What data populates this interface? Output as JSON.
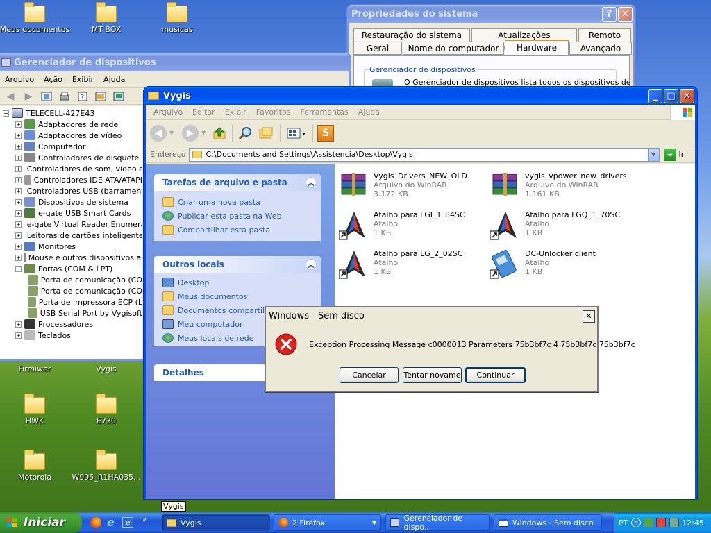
{
  "desktop": {
    "icons": [
      {
        "label": "Meus documentos"
      },
      {
        "label": "MT BOX"
      },
      {
        "label": "musicas"
      },
      {
        "label": "Firmiwer"
      },
      {
        "label": "Vygis"
      },
      {
        "label": "HWK"
      },
      {
        "label": "E730"
      },
      {
        "label": "Motorola"
      },
      {
        "label": "W995_R1HA035..."
      }
    ]
  },
  "sysprops": {
    "title": "Propriedades do sistema",
    "help_glyph": "?",
    "close_glyph": "✕",
    "tabs_row1": [
      "Restauração do sistema",
      "Atualizações Automáticas",
      "Remoto"
    ],
    "tabs_row2": [
      "Geral",
      "Nome do computador",
      "Hardware",
      "Avançado"
    ],
    "group_label": "Gerenciador de dispositivos",
    "group_text": "O Gerenciador de dispositivos lista todos os dispositivos de"
  },
  "devmgr": {
    "title": "Gerenciador de dispositivos",
    "menu": [
      "Arquivo",
      "Ação",
      "Exibir",
      "Ajuda"
    ],
    "root": "TELECELL-427E43",
    "items": [
      {
        "label": "Adaptadores de rede",
        "icon": "network-icon"
      },
      {
        "label": "Adaptadores de vídeo",
        "icon": "display-icon"
      },
      {
        "label": "Computador",
        "icon": "computer-icon"
      },
      {
        "label": "Controladores de disquete",
        "icon": "floppy-icon"
      },
      {
        "label": "Controladores de som, vídeo e",
        "icon": "sound-icon"
      },
      {
        "label": "Controladores IDE ATA/ATAPI",
        "icon": "ide-icon"
      },
      {
        "label": "Controladores USB (barrament",
        "icon": "usb-icon"
      },
      {
        "label": "Dispositivos de sistema",
        "icon": "system-icon"
      },
      {
        "label": "e-gate USB Smart Cards",
        "icon": "smartcard-icon"
      },
      {
        "label": "e-gate Virtual Reader Enumera",
        "icon": "smartcard-icon"
      },
      {
        "label": "Leitoras de cartões inteligentes",
        "icon": "cardreader-icon"
      },
      {
        "label": "Monitores",
        "icon": "monitor-icon"
      },
      {
        "label": "Mouse e outros dispositivos ap",
        "icon": "mouse-icon"
      },
      {
        "label": "Portas (COM & LPT)",
        "icon": "port-icon"
      }
    ],
    "ports_children": [
      "Porta de comunicação (CO",
      "Porta de comunicação (CO",
      "Porta de impressora ECP (L",
      "USB Serial Port by Vygisoft"
    ],
    "after_ports": [
      {
        "label": "Processadores",
        "icon": "cpu-icon"
      },
      {
        "label": "Teclados",
        "icon": "keyboard-icon"
      }
    ]
  },
  "explorer": {
    "title": "Vygis",
    "menu": [
      "Arquivo",
      "Editar",
      "Exibir",
      "Favoritos",
      "Ferramentas",
      "Ajuda"
    ],
    "address_label": "Endereço",
    "address_value": "C:\\Documents and Settings\\Assistencia\\Desktop\\Vygis",
    "go_label": "Ir",
    "tasks_title": "Tarefas de arquivo e pasta",
    "tasks": [
      "Criar uma nova pasta",
      "Publicar esta pasta na Web",
      "Compartilhar esta pasta"
    ],
    "places_title": "Outros locais",
    "places": [
      "Desktop",
      "Meus documentos",
      "Documentos compartilhados",
      "Meu computador",
      "Meus locais de rede"
    ],
    "details_title": "Detalhes",
    "files": [
      {
        "name": "Vygis_Drivers_NEW_OLD",
        "type": "Arquivo do WinRAR",
        "size": "3.172 KB",
        "icon": "winrar-icon"
      },
      {
        "name": "vygis_vpower_new_drivers",
        "type": "Arquivo do WinRAR",
        "size": "1.161 KB",
        "icon": "winrar-icon"
      },
      {
        "name": "Atalho para LGI_1_84SC",
        "type": "Atalho",
        "size": "1 KB",
        "icon": "shortcut-arrow-icon"
      },
      {
        "name": "Atalho para LGQ_1_70SC",
        "type": "Atalho",
        "size": "1 KB",
        "icon": "shortcut-arrow-icon"
      },
      {
        "name": "Atalho para LG_2_02SC",
        "type": "Atalho",
        "size": "1 KB",
        "icon": "shortcut-arrow-icon"
      },
      {
        "name": "DC-Unlocker client",
        "type": "Atalho",
        "size": "1 KB",
        "icon": "dc-unlocker-icon"
      }
    ]
  },
  "dialog": {
    "title": "Windows - Sem disco",
    "close_glyph": "✕",
    "message": "Exception Processing Message c0000013 Parameters 75b3bf7c 4 75b3bf7c 75b3bf7c",
    "buttons": [
      "Cancelar",
      "Tentar novame",
      "Continuar"
    ]
  },
  "tooltip": "Vygis",
  "taskbar": {
    "start_label": "Iniciar",
    "tasks": [
      {
        "label": "Vygis",
        "active": true
      },
      {
        "label": "2 Firefox",
        "active": false
      },
      {
        "label": "Gerenciador de dispo...",
        "active": false
      },
      {
        "label": "Windows - Sem disco",
        "active": false
      }
    ],
    "lang": "PT",
    "clock": "12:45"
  },
  "colors": {
    "xp_title_blue": "#0050ee",
    "error_red": "#d8221b",
    "link_blue": "#215dc6",
    "start_green": "#3c9a30"
  }
}
